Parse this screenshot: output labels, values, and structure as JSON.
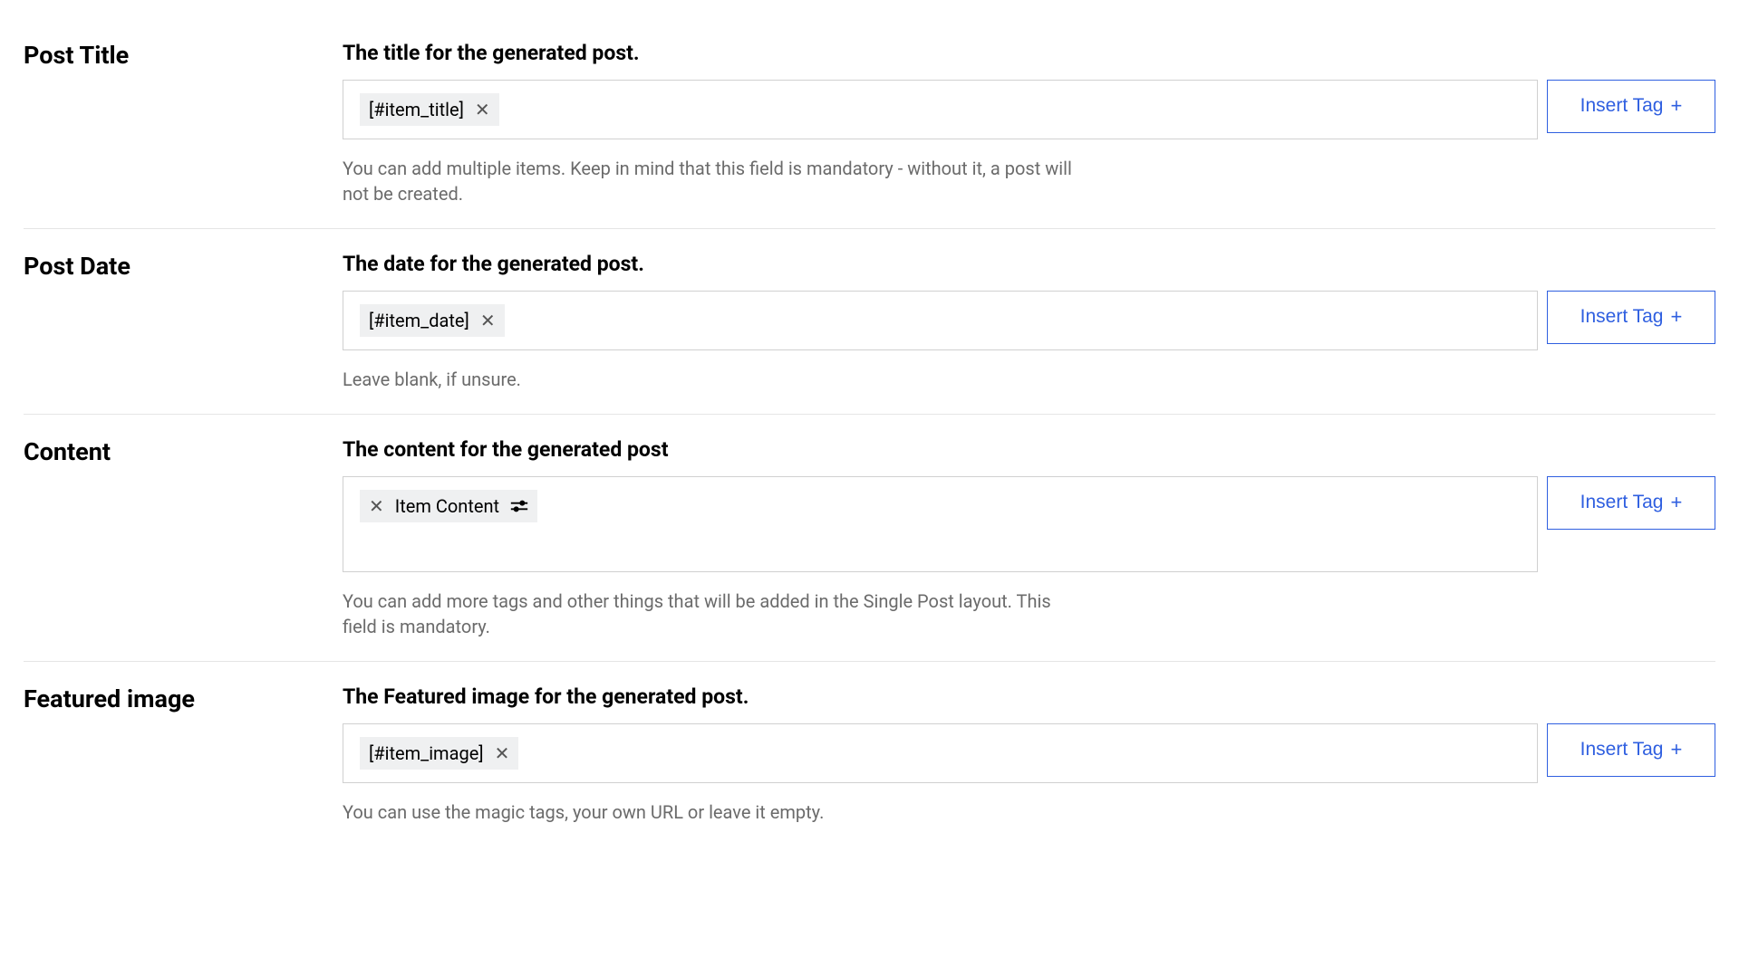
{
  "insert_tag_label": "Insert Tag",
  "fields": {
    "post_title": {
      "label": "Post Title",
      "description": "The title for the generated post.",
      "tag_text": "[#item_title]",
      "help": "You can add multiple items. Keep in mind that this field is mandatory - without it, a post will not be created."
    },
    "post_date": {
      "label": "Post Date",
      "description": "The date for the generated post.",
      "tag_text": "[#item_date]",
      "help": "Leave blank, if unsure."
    },
    "content": {
      "label": "Content",
      "description": "The content for the generated post",
      "tag_text": "Item Content",
      "help": "You can add more tags and other things that will be added in the Single Post layout. This field is mandatory."
    },
    "featured_image": {
      "label": "Featured image",
      "description": "The Featured image for the generated post.",
      "tag_text": "[#item_image]",
      "help": "You can use the magic tags, your own URL or leave it empty."
    }
  }
}
